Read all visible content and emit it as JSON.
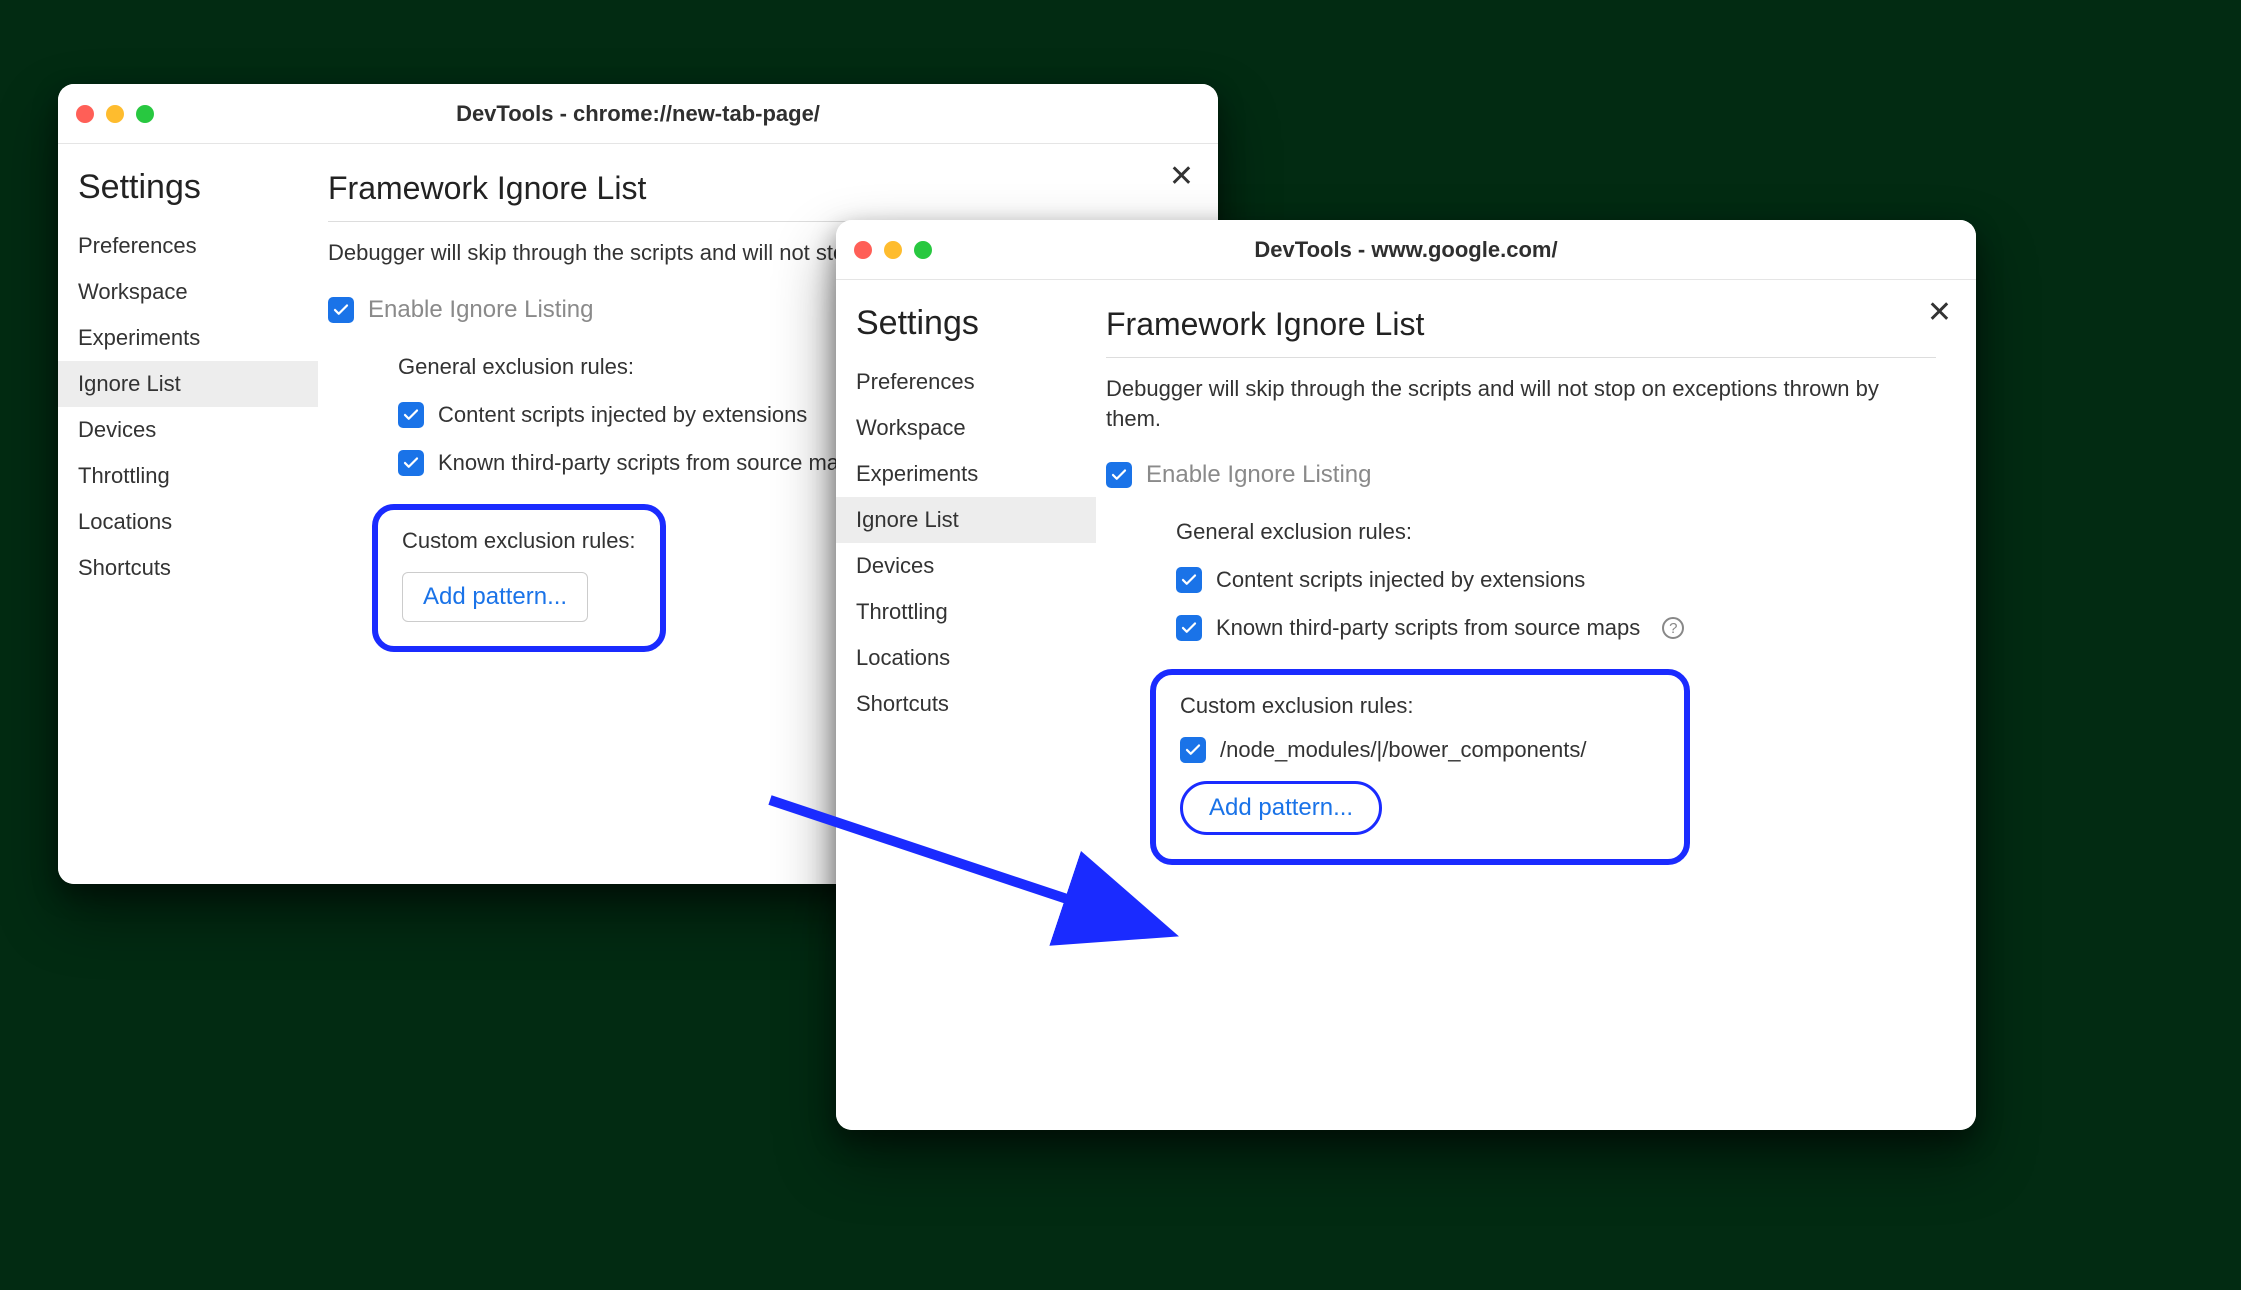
{
  "window1": {
    "title": "DevTools - chrome://new-tab-page/",
    "settings_label": "Settings",
    "sidebar": [
      "Preferences",
      "Workspace",
      "Experiments",
      "Ignore List",
      "Devices",
      "Throttling",
      "Locations",
      "Shortcuts"
    ],
    "selected_index": 3,
    "heading": "Framework Ignore List",
    "desc": "Debugger will skip through the scripts and will not stop on exceptions thrown by them.",
    "enable_label": "Enable Ignore Listing",
    "general_label": "General exclusion rules:",
    "rule1": "Content scripts injected by extensions",
    "rule2": "Known third-party scripts from source maps",
    "custom_label": "Custom exclusion rules:",
    "add_pattern": "Add pattern..."
  },
  "window2": {
    "title": "DevTools - www.google.com/",
    "settings_label": "Settings",
    "sidebar": [
      "Preferences",
      "Workspace",
      "Experiments",
      "Ignore List",
      "Devices",
      "Throttling",
      "Locations",
      "Shortcuts"
    ],
    "selected_index": 3,
    "heading": "Framework Ignore List",
    "desc": "Debugger will skip through the scripts and will not stop on exceptions thrown by them.",
    "enable_label": "Enable Ignore Listing",
    "general_label": "General exclusion rules:",
    "rule1": "Content scripts injected by extensions",
    "rule2": "Known third-party scripts from source maps",
    "custom_label": "Custom exclusion rules:",
    "pattern1": "/node_modules/|/bower_components/",
    "add_pattern": "Add pattern..."
  }
}
